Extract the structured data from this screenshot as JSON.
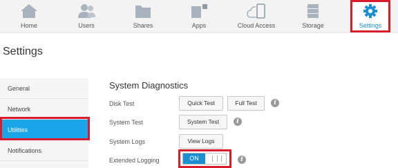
{
  "nav": {
    "items": [
      {
        "label": "Home",
        "icon": "home-icon"
      },
      {
        "label": "Users",
        "icon": "users-icon"
      },
      {
        "label": "Shares",
        "icon": "folder-icon"
      },
      {
        "label": "Apps",
        "icon": "apps-icon"
      },
      {
        "label": "Cloud Access",
        "icon": "cloud-access-icon"
      },
      {
        "label": "Storage",
        "icon": "storage-icon"
      },
      {
        "label": "Settings",
        "icon": "gear-icon"
      }
    ],
    "active": "Settings"
  },
  "page": {
    "title": "Settings"
  },
  "sidebar": {
    "items": [
      {
        "label": "General"
      },
      {
        "label": "Network"
      },
      {
        "label": "Utilities"
      },
      {
        "label": "Notifications"
      }
    ],
    "active": "Utilities"
  },
  "diagnostics": {
    "title": "System Diagnostics",
    "disk_test": {
      "label": "Disk Test",
      "quick": "Quick Test",
      "full": "Full Test"
    },
    "system_test": {
      "label": "System Test",
      "button": "System Test"
    },
    "system_logs": {
      "label": "System Logs",
      "button": "View Logs"
    },
    "extended_logging": {
      "label": "Extended Logging",
      "state": "ON"
    }
  },
  "colors": {
    "accent": "#1b8fd2",
    "sidebar_active": "#1ba6ea",
    "highlight": "#d81c2c"
  }
}
